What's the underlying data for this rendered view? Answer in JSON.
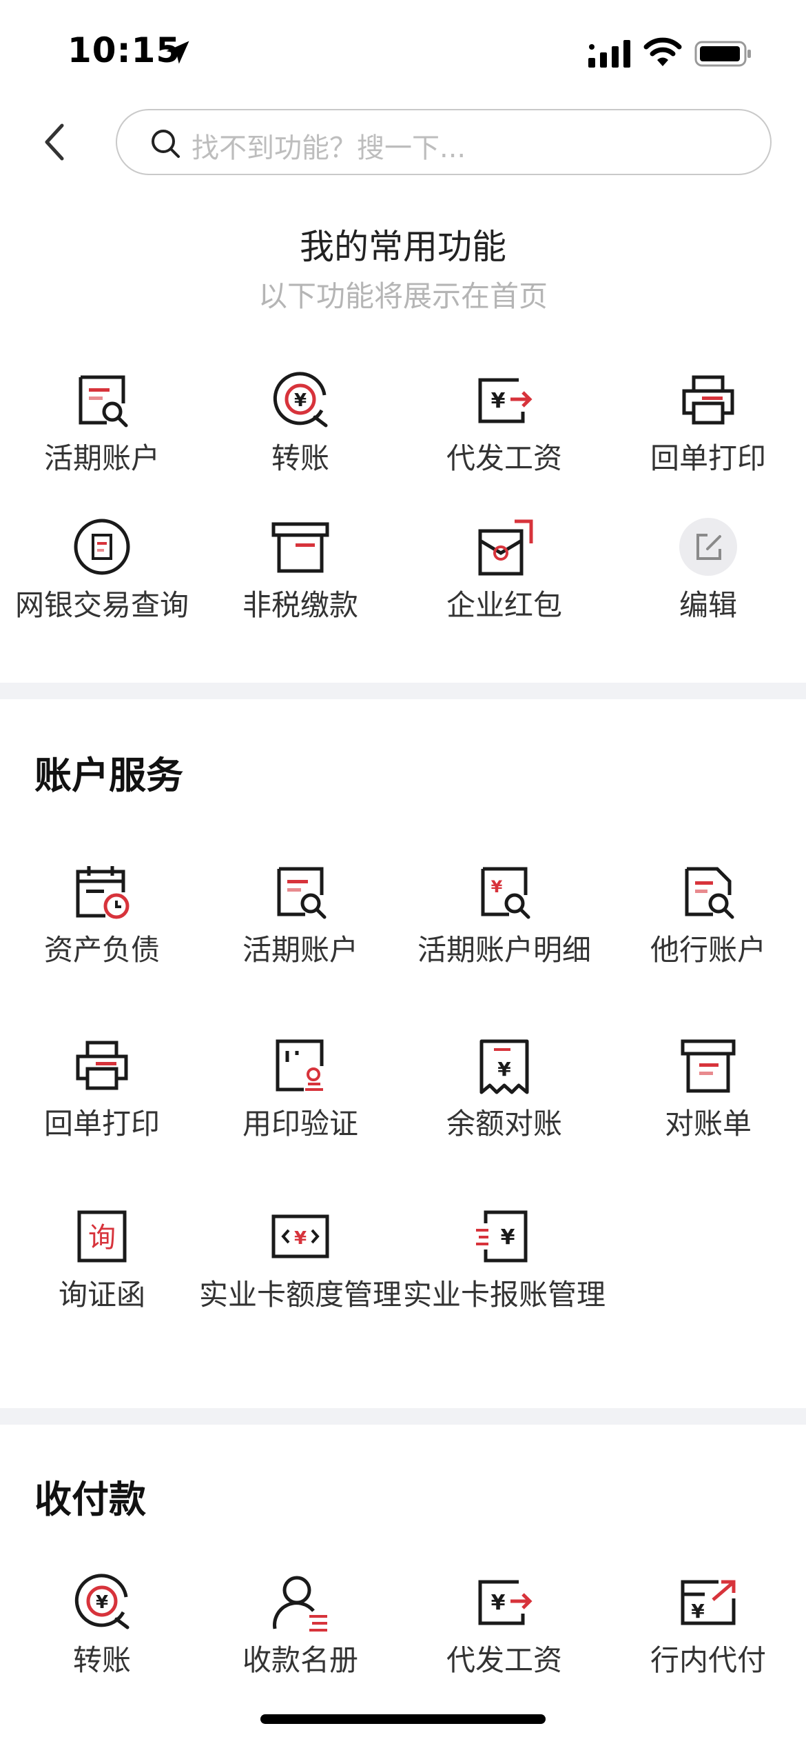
{
  "status_bar": {
    "time": "10:15"
  },
  "search": {
    "placeholder": "找不到功能？搜一下..."
  },
  "favorites": {
    "title": "我的常用功能",
    "subtitle": "以下功能将展示在首页",
    "items": [
      {
        "label": "活期账户",
        "icon": "account-search-icon"
      },
      {
        "label": "转账",
        "icon": "transfer-icon"
      },
      {
        "label": "代发工资",
        "icon": "salary-icon"
      },
      {
        "label": "回单打印",
        "icon": "printer-icon"
      },
      {
        "label": "网银交易查询",
        "icon": "transaction-query-icon"
      },
      {
        "label": "非税缴款",
        "icon": "tax-payment-icon"
      },
      {
        "label": "企业红包",
        "icon": "red-envelope-icon"
      },
      {
        "label": "编辑",
        "icon": "edit-icon"
      }
    ]
  },
  "account_services": {
    "title": "账户服务",
    "items": [
      {
        "label": "资产负债",
        "icon": "calendar-clock-icon"
      },
      {
        "label": "活期账户",
        "icon": "account-search-icon"
      },
      {
        "label": "活期账户明细",
        "icon": "account-detail-icon"
      },
      {
        "label": "他行账户",
        "icon": "other-bank-account-icon"
      },
      {
        "label": "回单打印",
        "icon": "printer-icon"
      },
      {
        "label": "用印验证",
        "icon": "seal-verify-icon"
      },
      {
        "label": "余额对账",
        "icon": "balance-receipt-icon"
      },
      {
        "label": "对账单",
        "icon": "statement-icon"
      },
      {
        "label": "询证函",
        "icon": "inquiry-letter-icon"
      },
      {
        "label": "实业卡额度管理",
        "icon": "card-limit-icon"
      },
      {
        "label": "实业卡报账管理",
        "icon": "card-expense-icon"
      }
    ]
  },
  "payments": {
    "title": "收付款",
    "items": [
      {
        "label": "转账",
        "icon": "transfer-icon"
      },
      {
        "label": "收款名册",
        "icon": "payee-list-icon"
      },
      {
        "label": "代发工资",
        "icon": "salary-icon"
      },
      {
        "label": "行内代付",
        "icon": "intra-bank-pay-icon"
      }
    ]
  },
  "colors": {
    "accent": "#d7333b",
    "icon_stroke": "#1a1a1a",
    "divider": "#f1f2f5"
  }
}
